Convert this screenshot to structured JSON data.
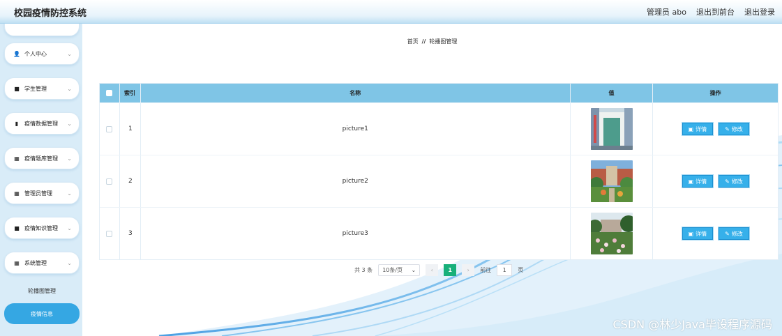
{
  "header": {
    "title": "校园疫情防控系统",
    "user": "管理员 abo",
    "front_link": "退出到前台",
    "logout": "退出登录"
  },
  "sidebar": {
    "items": [
      {
        "label": "个人中心",
        "icon": "person-icon"
      },
      {
        "label": "学生管理",
        "icon": "briefcase-icon"
      },
      {
        "label": "疫情数据管理",
        "icon": "bar-chart-icon"
      },
      {
        "label": "疫情题库管理",
        "icon": "grid-icon"
      },
      {
        "label": "管理员管理",
        "icon": "grid-icon"
      },
      {
        "label": "疫情知识管理",
        "icon": "briefcase-icon"
      },
      {
        "label": "系统管理",
        "icon": "grid-icon"
      }
    ],
    "sub_items": [
      {
        "label": "轮播图管理",
        "active": false
      },
      {
        "label": "疫情信息",
        "active": true
      }
    ]
  },
  "breadcrumb": {
    "home": "首页",
    "sep": "//",
    "current": "轮播图管理"
  },
  "table": {
    "headers": {
      "index": "索引",
      "name": "名称",
      "value": "值",
      "ops": "操作"
    },
    "rows": [
      {
        "index": "1",
        "name": "picture1",
        "image": "corridor-photo"
      },
      {
        "index": "2",
        "name": "picture2",
        "image": "campus-garden-photo"
      },
      {
        "index": "3",
        "name": "picture3",
        "image": "flower-field-photo"
      }
    ],
    "detail_label": "详情",
    "edit_label": "修改"
  },
  "pagination": {
    "total": "共 3 条",
    "page_size": "10条/页",
    "current_page": "1",
    "goto_label": "前往",
    "goto_value": "1",
    "page_unit": "页"
  },
  "watermark": "CSDN @林少Java毕设程序源码",
  "colors": {
    "accent": "#35a7e3",
    "table_header": "#7fc5e6",
    "page_active": "#18b07a"
  }
}
